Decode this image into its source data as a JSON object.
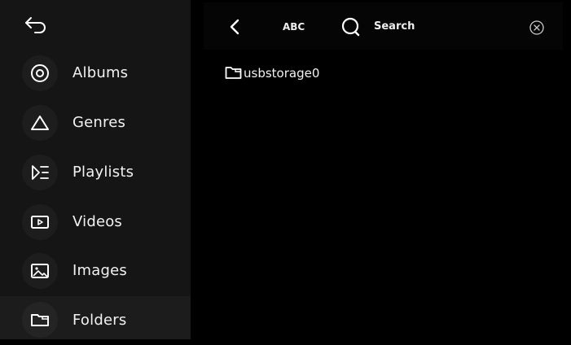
{
  "sidebar": {
    "back": {
      "icon": "return-arrow-icon"
    },
    "items": [
      {
        "label": "Albums",
        "icon": "album-disc-icon",
        "active": false
      },
      {
        "label": "Genres",
        "icon": "triangle-icon",
        "active": false
      },
      {
        "label": "Playlists",
        "icon": "playlist-icon",
        "active": false
      },
      {
        "label": "Videos",
        "icon": "video-icon",
        "active": false
      },
      {
        "label": "Images",
        "icon": "image-icon",
        "active": false
      },
      {
        "label": "Folders",
        "icon": "folder-icon",
        "active": true
      }
    ]
  },
  "topbar": {
    "back_icon": "chevron-left-icon",
    "abc_label": "ABC",
    "search_icon": "search-icon",
    "search_label": "Search",
    "clear_icon": "close-circle-icon"
  },
  "main": {
    "folders": [
      {
        "name": "usbstorage0",
        "icon": "folder-icon"
      }
    ]
  },
  "colors": {
    "background": "#000000",
    "sidebar": "#151515",
    "active_item": "#1c1c1c",
    "text": "#f2f2f2"
  }
}
